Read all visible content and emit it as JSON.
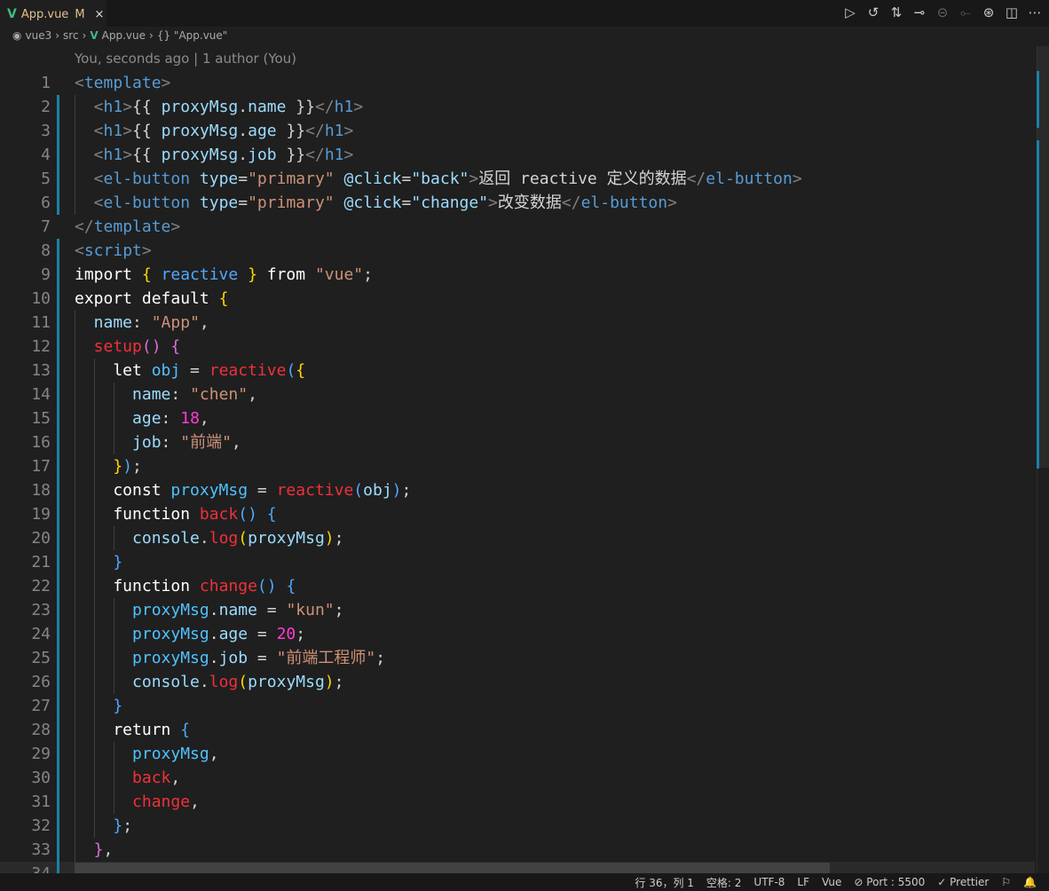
{
  "tab": {
    "icon": "vue-icon",
    "label": "App.vue",
    "status": "M",
    "close": "×"
  },
  "actions": [
    {
      "name": "run-icon",
      "glyph": "▷"
    },
    {
      "name": "timeline-icon",
      "glyph": "↺"
    },
    {
      "name": "compare-changes-icon",
      "glyph": "⇅"
    },
    {
      "name": "previous-commit-icon",
      "glyph": "⊸"
    },
    {
      "name": "commit-icon",
      "glyph": "⊝"
    },
    {
      "name": "next-commit-icon",
      "glyph": "⟜"
    },
    {
      "name": "git-graph-icon",
      "glyph": "⊛"
    },
    {
      "name": "split-editor-icon",
      "glyph": "◫"
    },
    {
      "name": "more-actions-icon",
      "glyph": "⋯"
    }
  ],
  "breadcrumb": {
    "items": [
      "vue3",
      "src",
      "App.vue",
      "{} \"App.vue\""
    ]
  },
  "blame": "You, seconds ago | 1 author (You)",
  "code": [
    [
      [
        "p",
        "<"
      ],
      [
        "t",
        "template"
      ],
      [
        "p",
        ">"
      ]
    ],
    [
      [
        "p",
        "  <"
      ],
      [
        "t",
        "h1"
      ],
      [
        "p",
        ">"
      ],
      [
        "pl",
        "{{ "
      ],
      [
        "a",
        "proxyMsg"
      ],
      [
        "pl",
        "."
      ],
      [
        "a",
        "name"
      ],
      [
        "pl",
        " }}"
      ],
      [
        "p",
        "</"
      ],
      [
        "t",
        "h1"
      ],
      [
        "p",
        ">"
      ]
    ],
    [
      [
        "p",
        "  <"
      ],
      [
        "t",
        "h1"
      ],
      [
        "p",
        ">"
      ],
      [
        "pl",
        "{{ "
      ],
      [
        "a",
        "proxyMsg"
      ],
      [
        "pl",
        "."
      ],
      [
        "a",
        "age"
      ],
      [
        "pl",
        " }}"
      ],
      [
        "p",
        "</"
      ],
      [
        "t",
        "h1"
      ],
      [
        "p",
        ">"
      ]
    ],
    [
      [
        "p",
        "  <"
      ],
      [
        "t",
        "h1"
      ],
      [
        "p",
        ">"
      ],
      [
        "pl",
        "{{ "
      ],
      [
        "a",
        "proxyMsg"
      ],
      [
        "pl",
        "."
      ],
      [
        "a",
        "job"
      ],
      [
        "pl",
        " }}"
      ],
      [
        "p",
        "</"
      ],
      [
        "t",
        "h1"
      ],
      [
        "p",
        ">"
      ]
    ],
    [
      [
        "p",
        "  <"
      ],
      [
        "t",
        "el-button"
      ],
      [
        "a",
        " type"
      ],
      [
        "pl",
        "="
      ],
      [
        "s",
        "\"primary\""
      ],
      [
        "a",
        " @click"
      ],
      [
        "pl",
        "="
      ],
      [
        "a",
        "\"back\""
      ],
      [
        "p",
        ">"
      ],
      [
        "pl",
        "返回 reactive 定义的数据"
      ],
      [
        "p",
        "</"
      ],
      [
        "t",
        "el-button"
      ],
      [
        "p",
        ">"
      ]
    ],
    [
      [
        "p",
        "  <"
      ],
      [
        "t",
        "el-button"
      ],
      [
        "a",
        " type"
      ],
      [
        "pl",
        "="
      ],
      [
        "s",
        "\"primary\""
      ],
      [
        "a",
        " @click"
      ],
      [
        "pl",
        "="
      ],
      [
        "a",
        "\"change\""
      ],
      [
        "p",
        ">"
      ],
      [
        "pl",
        "改变数据"
      ],
      [
        "p",
        "</"
      ],
      [
        "t",
        "el-button"
      ],
      [
        "p",
        ">"
      ]
    ],
    [
      [
        "p",
        "</"
      ],
      [
        "t",
        "template"
      ],
      [
        "p",
        ">"
      ]
    ],
    [
      [
        "p",
        "<"
      ],
      [
        "t",
        "script"
      ],
      [
        "p",
        ">"
      ]
    ],
    [
      [
        "k",
        "import "
      ],
      [
        "y",
        "{"
      ],
      [
        "b",
        " reactive "
      ],
      [
        "y",
        "}"
      ],
      [
        "k",
        " from "
      ],
      [
        "s",
        "\"vue\""
      ],
      [
        "pl",
        ";"
      ]
    ],
    [
      [
        "k",
        "export default "
      ],
      [
        "y",
        "{"
      ]
    ],
    [
      [
        "a",
        "  name"
      ],
      [
        "pl",
        ": "
      ],
      [
        "s",
        "\"App\""
      ],
      [
        "pl",
        ","
      ]
    ],
    [
      [
        "f",
        "  setup"
      ],
      [
        "m",
        "()"
      ],
      [
        "pl",
        " "
      ],
      [
        "m",
        "{"
      ]
    ],
    [
      [
        "k",
        "    let "
      ],
      [
        "v",
        "obj"
      ],
      [
        "pl",
        " = "
      ],
      [
        "f",
        "reactive"
      ],
      [
        "b",
        "("
      ],
      [
        "y",
        "{"
      ]
    ],
    [
      [
        "a",
        "      name"
      ],
      [
        "pl",
        ": "
      ],
      [
        "s",
        "\"chen\""
      ],
      [
        "pl",
        ","
      ]
    ],
    [
      [
        "a",
        "      age"
      ],
      [
        "pl",
        ": "
      ],
      [
        "n",
        "18"
      ],
      [
        "pl",
        ","
      ]
    ],
    [
      [
        "a",
        "      job"
      ],
      [
        "pl",
        ": "
      ],
      [
        "s",
        "\"前端\""
      ],
      [
        "pl",
        ","
      ]
    ],
    [
      [
        "y",
        "    }"
      ],
      [
        "b",
        ")"
      ],
      [
        "pl",
        ";"
      ]
    ],
    [
      [
        "k",
        "    const "
      ],
      [
        "v",
        "proxyMsg"
      ],
      [
        "pl",
        " = "
      ],
      [
        "f",
        "reactive"
      ],
      [
        "b",
        "("
      ],
      [
        "a",
        "obj"
      ],
      [
        "b",
        ")"
      ],
      [
        "pl",
        ";"
      ]
    ],
    [
      [
        "k",
        "    function "
      ],
      [
        "f",
        "back"
      ],
      [
        "b",
        "()"
      ],
      [
        "pl",
        " "
      ],
      [
        "b",
        "{"
      ]
    ],
    [
      [
        "a",
        "      console"
      ],
      [
        "pl",
        "."
      ],
      [
        "f",
        "log"
      ],
      [
        "y",
        "("
      ],
      [
        "a",
        "proxyMsg"
      ],
      [
        "y",
        ")"
      ],
      [
        "pl",
        ";"
      ]
    ],
    [
      [
        "b",
        "    }"
      ]
    ],
    [
      [
        "k",
        "    function "
      ],
      [
        "f",
        "change"
      ],
      [
        "b",
        "()"
      ],
      [
        "pl",
        " "
      ],
      [
        "b",
        "{"
      ]
    ],
    [
      [
        "v",
        "      proxyMsg"
      ],
      [
        "pl",
        "."
      ],
      [
        "a",
        "name"
      ],
      [
        "pl",
        " = "
      ],
      [
        "s",
        "\"kun\""
      ],
      [
        "pl",
        ";"
      ]
    ],
    [
      [
        "v",
        "      proxyMsg"
      ],
      [
        "pl",
        "."
      ],
      [
        "a",
        "age"
      ],
      [
        "pl",
        " = "
      ],
      [
        "n",
        "20"
      ],
      [
        "pl",
        ";"
      ]
    ],
    [
      [
        "v",
        "      proxyMsg"
      ],
      [
        "pl",
        "."
      ],
      [
        "a",
        "job"
      ],
      [
        "pl",
        " = "
      ],
      [
        "s",
        "\"前端工程师\""
      ],
      [
        "pl",
        ";"
      ]
    ],
    [
      [
        "a",
        "      console"
      ],
      [
        "pl",
        "."
      ],
      [
        "f",
        "log"
      ],
      [
        "y",
        "("
      ],
      [
        "a",
        "proxyMsg"
      ],
      [
        "y",
        ")"
      ],
      [
        "pl",
        ";"
      ]
    ],
    [
      [
        "b",
        "    }"
      ]
    ],
    [
      [
        "k",
        "    return "
      ],
      [
        "b",
        "{"
      ]
    ],
    [
      [
        "v",
        "      proxyMsg"
      ],
      [
        "pl",
        ","
      ]
    ],
    [
      [
        "f",
        "      back"
      ],
      [
        "pl",
        ","
      ]
    ],
    [
      [
        "f",
        "      change"
      ],
      [
        "pl",
        ","
      ]
    ],
    [
      [
        "b",
        "    }"
      ],
      [
        "pl",
        ";"
      ]
    ],
    [
      [
        "m",
        "  }"
      ],
      [
        "pl",
        ","
      ]
    ],
    [
      [
        "y",
        "}"
      ],
      [
        "pl",
        ";"
      ]
    ]
  ],
  "status": {
    "position": "行 36，列 1",
    "indent": "空格: 2",
    "encoding": "UTF-8",
    "eol": "LF",
    "language": "Vue",
    "port": "⊘ Port : 5500",
    "formatter": "✓ Prettier",
    "feedback": "⚐",
    "notifications": "🔔"
  }
}
